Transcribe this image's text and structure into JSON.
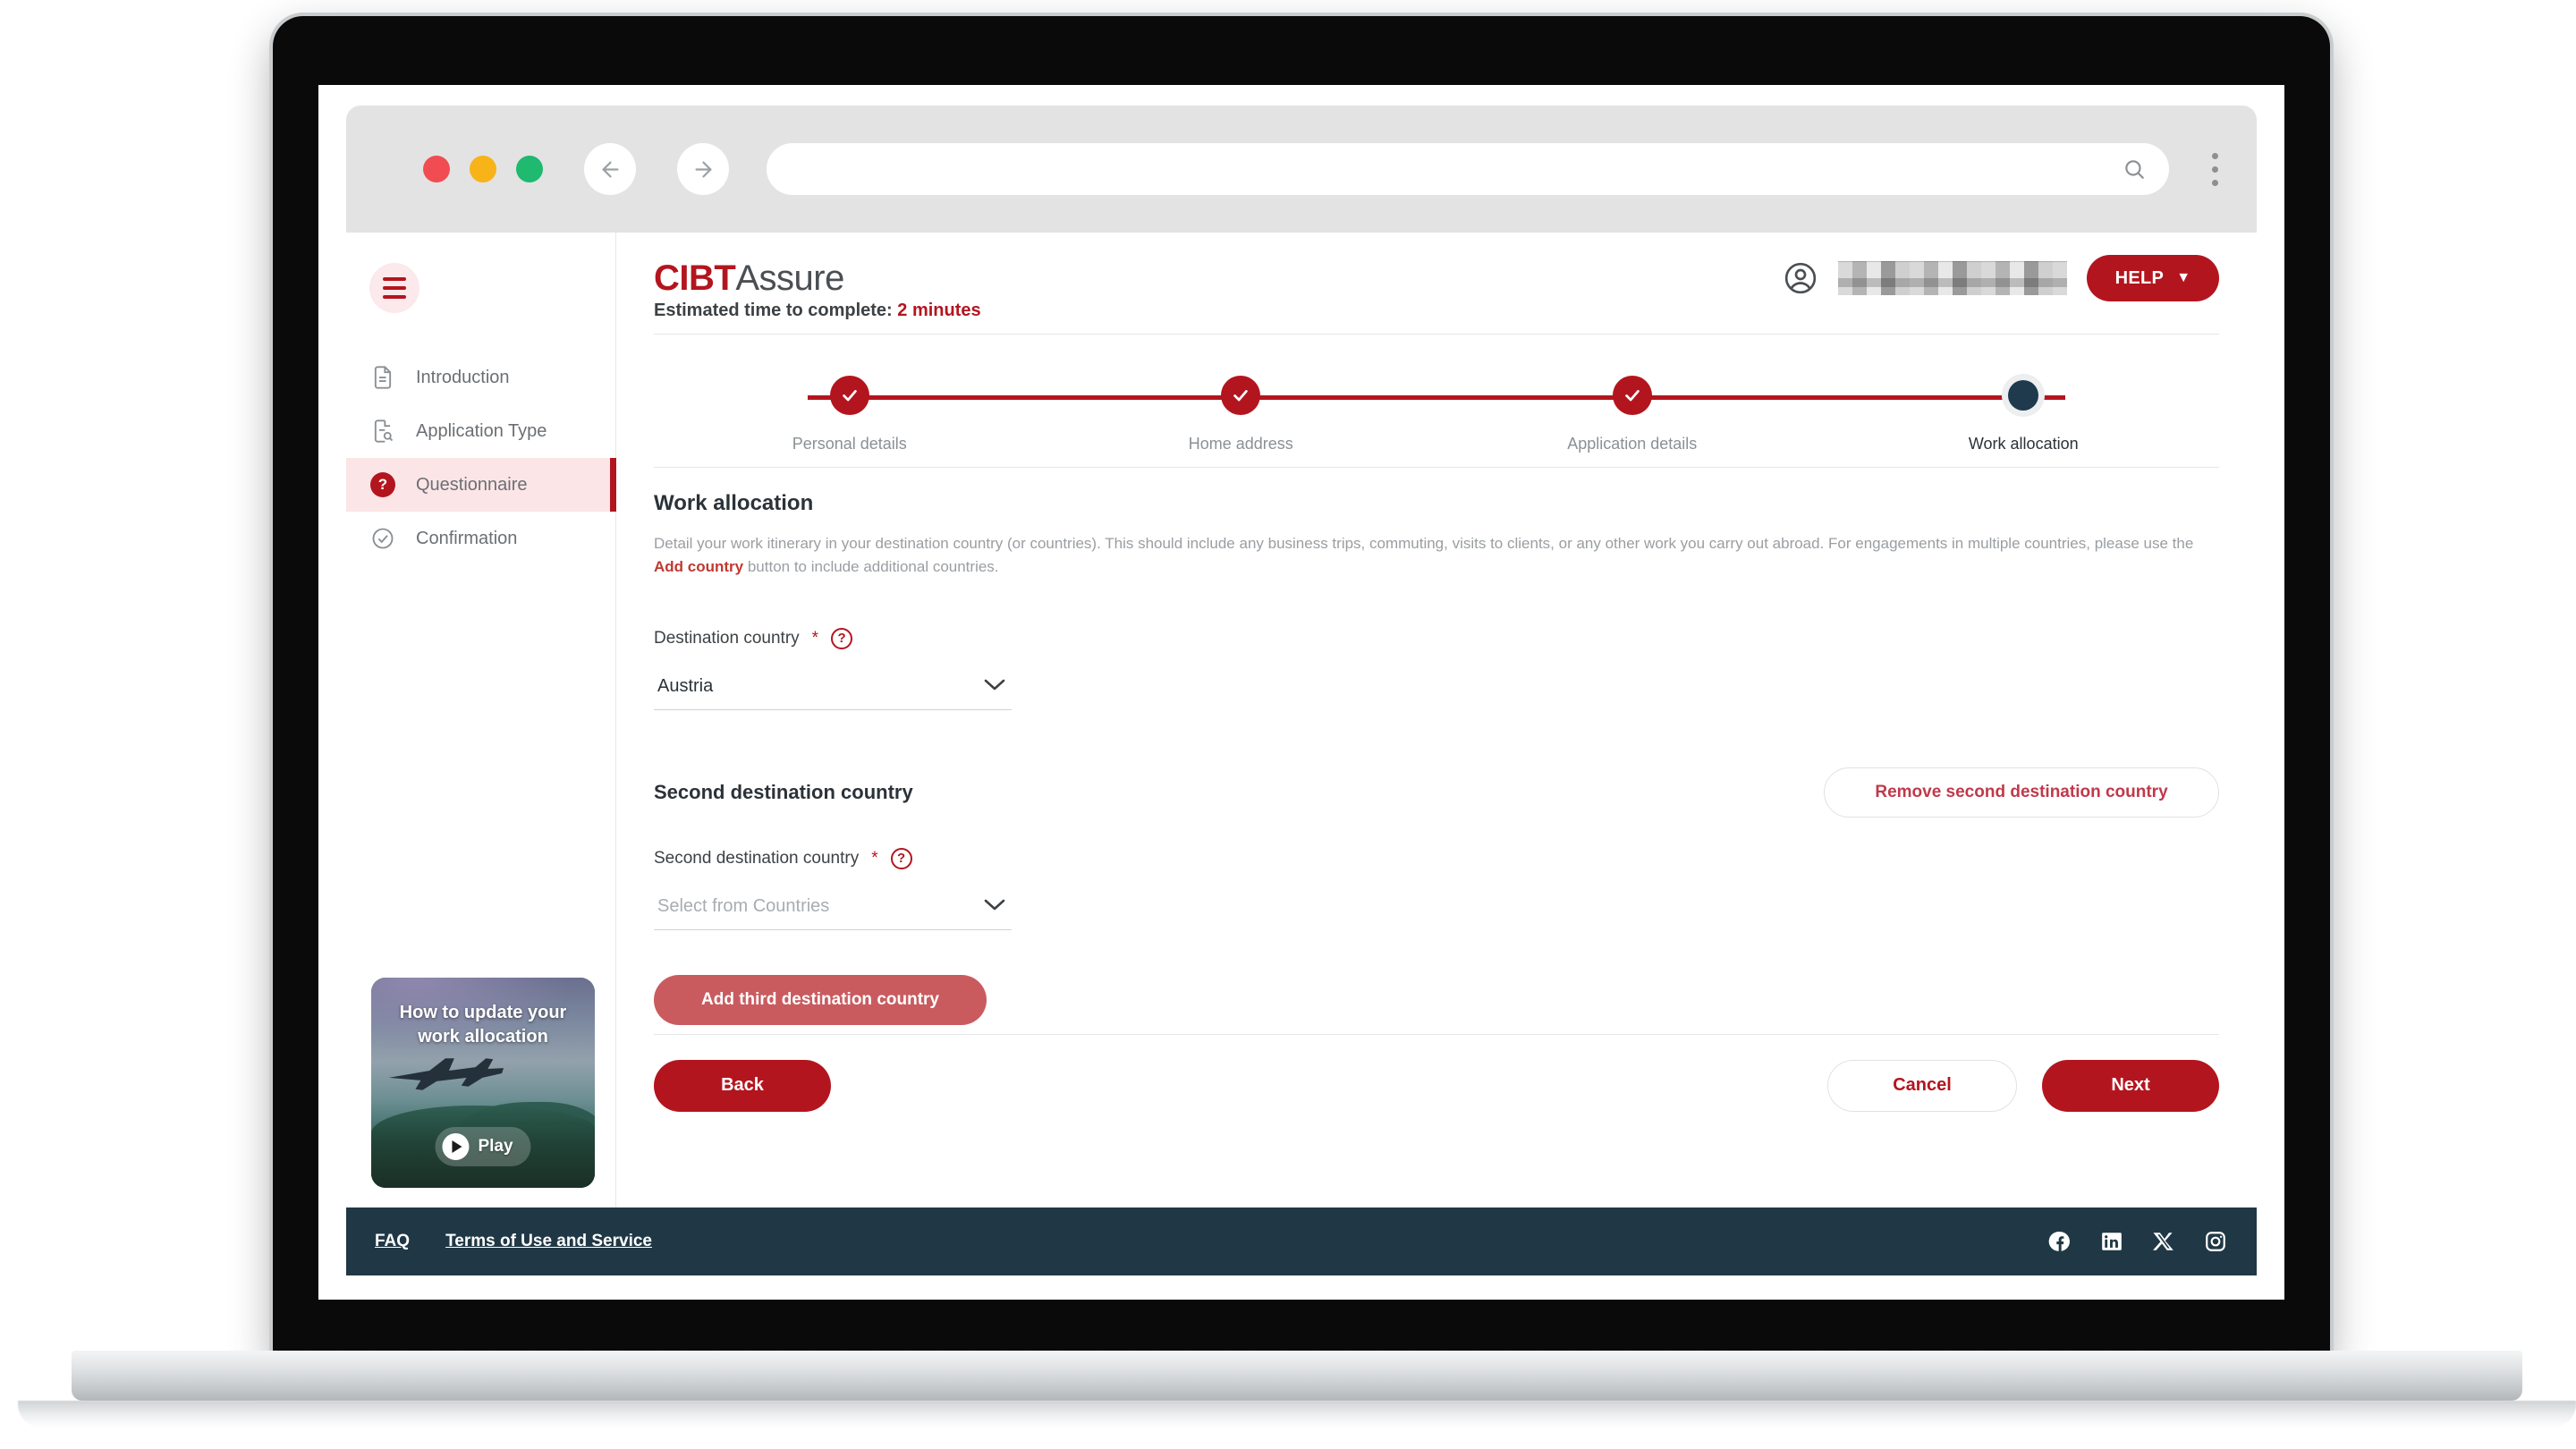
{
  "browser": {
    "url_value": "",
    "url_placeholder": "",
    "back_icon": "arrow-left-icon",
    "forward_icon": "arrow-right-icon",
    "search_icon": "search-icon",
    "menu_icon": "kebab-menu-icon",
    "traffic_lights": [
      "close-red",
      "minimize-amber",
      "maximize-green"
    ]
  },
  "sidebar": {
    "menu_icon": "hamburger-icon",
    "items": [
      {
        "label": "Introduction",
        "icon": "document-icon",
        "active": false
      },
      {
        "label": "Application Type",
        "icon": "document-search-icon",
        "active": false
      },
      {
        "label": "Questionnaire",
        "icon": "question-badge-icon",
        "active": true
      },
      {
        "label": "Confirmation",
        "icon": "check-circle-icon",
        "active": false
      }
    ],
    "video": {
      "title": "How to update your work allocation",
      "play_label": "Play",
      "play_icon": "play-icon"
    }
  },
  "header": {
    "brand_primary": "CIBT",
    "brand_secondary": "Assure",
    "avatar_icon": "account-circle-icon",
    "user_name": "",
    "help_label": "HELP",
    "help_caret_icon": "chevron-down-icon",
    "estimate_prefix": "Estimated time to complete:",
    "estimate_value": "2 minutes"
  },
  "stepper": {
    "steps": [
      {
        "label": "Personal details",
        "state": "done",
        "icon": "check-icon"
      },
      {
        "label": "Home address",
        "state": "done",
        "icon": "check-icon"
      },
      {
        "label": "Application details",
        "state": "done",
        "icon": "check-icon"
      },
      {
        "label": "Work allocation",
        "state": "current",
        "icon": "dot-icon"
      }
    ]
  },
  "form": {
    "section_title": "Work allocation",
    "description_part1": "Detail your work itinerary in your destination country (or countries). This should include any business trips, commuting, visits to clients, or any other work you carry out abroad. For engagements in multiple countries, please use the ",
    "description_link": "Add country",
    "description_part2": " button to include additional countries.",
    "destination": {
      "label": "Destination country",
      "required_mark": "*",
      "help_icon": "question-mark-icon",
      "value": "Austria",
      "caret_icon": "chevron-down-icon"
    },
    "second_section_heading": "Second destination country",
    "remove_second_label": "Remove second destination country",
    "second_destination": {
      "label": "Second destination country",
      "required_mark": "*",
      "help_icon": "question-mark-icon",
      "value": "",
      "placeholder": "Select from Countries",
      "caret_icon": "chevron-down-icon"
    },
    "add_third_label": "Add third destination country",
    "back_label": "Back",
    "cancel_label": "Cancel",
    "next_label": "Next"
  },
  "footer": {
    "links": [
      "FAQ",
      "Terms of Use and Service"
    ],
    "social": [
      "facebook-icon",
      "linkedin-icon",
      "x-twitter-icon",
      "instagram-icon"
    ]
  },
  "colors": {
    "brand_red": "#B3151F",
    "muted_red": "#C95B5F",
    "outline_red": "#C0394A",
    "footer_navy": "#203845",
    "current_step_navy": "#1E3A4C",
    "active_nav_bg": "#FBE5E7"
  }
}
